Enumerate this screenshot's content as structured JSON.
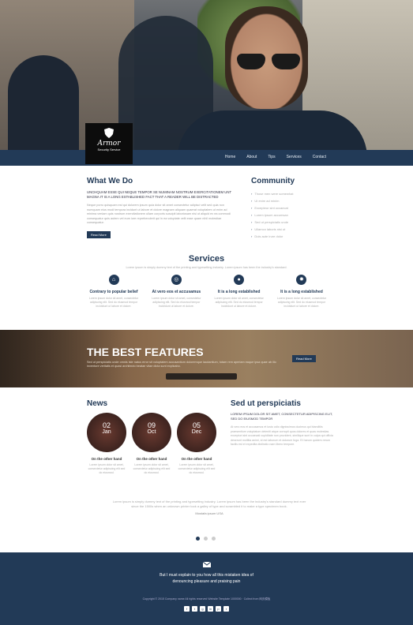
{
  "logo": {
    "brand": "Armor",
    "tagline": "Security Service"
  },
  "nav": [
    "Home",
    "About",
    "Tips",
    "Services",
    "Contact"
  ],
  "what_we_do": {
    "title": "What We Do",
    "lead": "UNCHQUAM ESSE QUI NEQUE TEMPOR SE NUMINAM NOSTRUM EXERCITATIONEM UNT MAGNA IT IS A LONG ESTABLISHED FACT THAT A READER WILL BE DISTRACTED",
    "body": "Neque porro quisquam est qui dolorem ipsum quia dolor sit amet consectetur adipisci velit sed quia non numquam eius modi tempora incidunt ut labore et dolore magnam aliquam quaerat voluptatem ut enim ad minima veniam quis nostrum exercitationem ullam corporis suscipit laboriosam nisi ut aliquid ex ea commodi consequatur quis autem vel eum iure reprehenderit qui in ea voluptate velit esse quam nihil molestiae consequatur.",
    "button": "Read More"
  },
  "community": {
    "title": "Community",
    "items": [
      "Those men were somewhat",
      "Ut enim ad minim",
      "Excepteur sint occaecat",
      "Lorem ipsum accumsan",
      "Sed ut perspiciatis unde",
      "Ullamco laboris nisi ut",
      "Duis aute irure dolor"
    ]
  },
  "services": {
    "title": "Services",
    "intro": "Lorem ipsum is simply dummy text of the printing and typesetting industry. Lorem ipsum has been the industry's standard.",
    "items": [
      {
        "icon": "home-icon",
        "title": "Contrary to popular belief",
        "text": "Lorem ipsum dolor sit amet, consectetur adipiscing elit. Sed do eiusmod tempor incididunt ut labore et dolore."
      },
      {
        "icon": "target-icon",
        "title": "At vero eos et accusamus",
        "text": "Lorem ipsum dolor sit amet, consectetur adipiscing elit. Sed do eiusmod tempor incididunt ut labore et dolore."
      },
      {
        "icon": "person-icon",
        "title": "It is a long established",
        "text": "Lorem ipsum dolor sit amet, consectetur adipiscing elit. Sed do eiusmod tempor incididunt ut labore et dolore."
      },
      {
        "icon": "gear-icon",
        "title": "It is a long established",
        "text": "Lorem ipsum dolor sit amet, consectetur adipiscing elit. Sed do eiusmod tempor incididunt ut labore et dolore."
      }
    ]
  },
  "features": {
    "title": "THE BEST FEATURES",
    "text": "Sed ut perspiciatis unde omnis iste natus error sit voluptatem accusantium doloremque laudantium, totam rem aperiam eaque ipsa quae ab illo inventore veritatis et quasi architecto beatae vitae dicta sunt explicabo.",
    "button": "Read More"
  },
  "news": {
    "title": "News",
    "items": [
      {
        "day": "02",
        "month": "Jan",
        "title": "On the other hand",
        "text": "Lorem ipsum dolor sit amet, consectetur adipiscing elit sed do eiusmod."
      },
      {
        "day": "09",
        "month": "Oct",
        "title": "On the other hand",
        "text": "Lorem ipsum dolor sit amet, consectetur adipiscing elit sed do eiusmod."
      },
      {
        "day": "05",
        "month": "Dec",
        "title": "On the other hand",
        "text": "Lorem ipsum dolor sit amet, consectetur adipiscing elit sed do eiusmod."
      }
    ]
  },
  "sed": {
    "title": "Sed ut perspiciatis",
    "lead": "LOREM IPSUM DOLOR SIT AMET, CONSECTETUR ADIPISCING ELIT, SED DO EIUSMOD TEMPOR",
    "body": "At vero eos et accusamus et iusto odio dignissimos ducimus qui blanditiis praesentium voluptatum deleniti atque corrupti quos dolores et quas molestias excepturi sint occaecati cupiditate non provident, similique sunt in culpa qui officia deserunt mollitia animi, id est laborum et dolorum fuga. Et harum quidem rerum facilis est et expedita distinctio nam libero tempore."
  },
  "testimonial": {
    "text": "Lorem ipsum is simply dummy text of the printing and typesetting industry. Lorem ipsum has been the industry's standard dummy text ever since the 1500s when an unknown printer took a galley of type and scrambled it to make a type specimen book.",
    "author": "Mostafa ipsum USA"
  },
  "footer": {
    "quote": "But I must explain to you how all this mistaken idea of denouncing pleasure and praising pain",
    "copyright": "Copyright © 2015 Company name All rights reserved Website Template 1000000 · Collect from 网页模板",
    "social": [
      "f",
      "t",
      "g",
      "in",
      "p",
      "r"
    ]
  }
}
